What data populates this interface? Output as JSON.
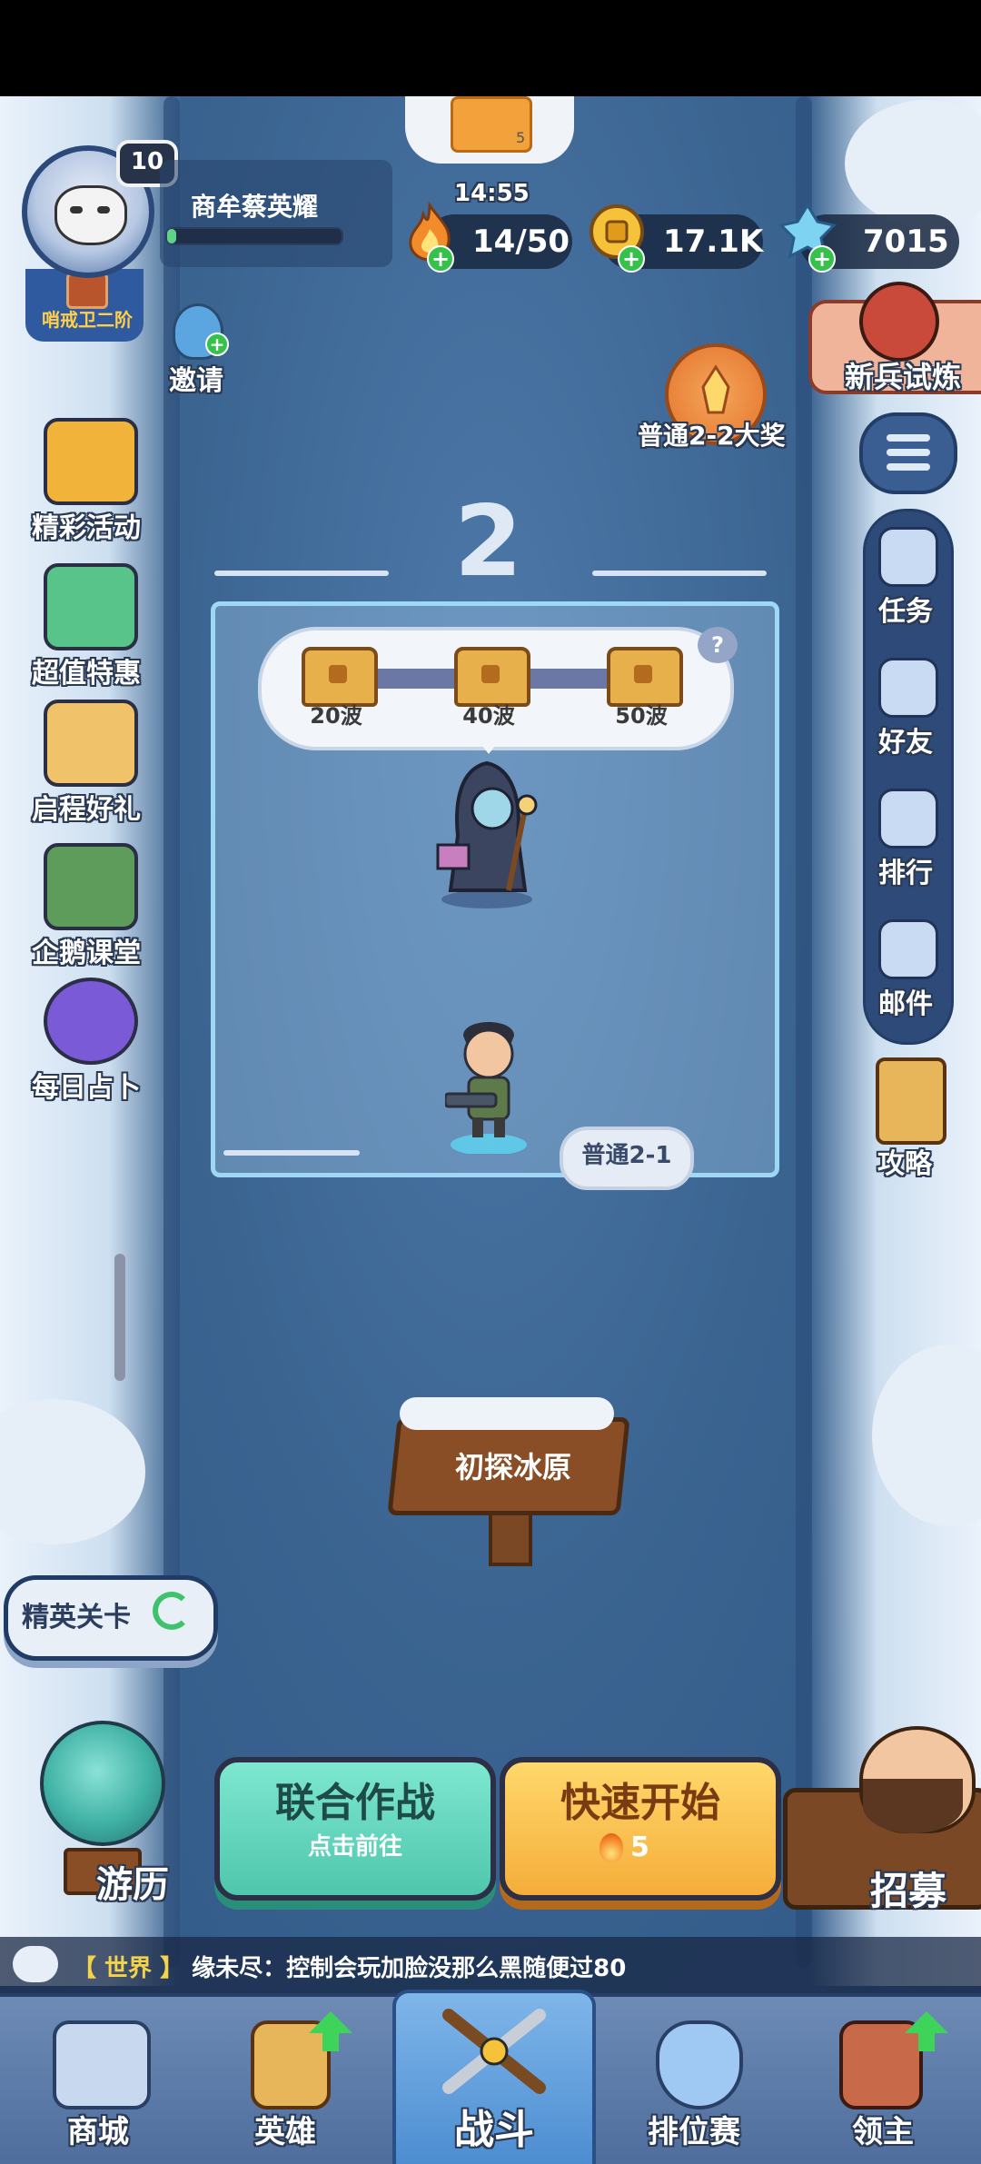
{
  "player": {
    "level": "10",
    "name": "商牟蔡英耀",
    "rank": "哨戒卫二阶",
    "xp_fraction": 0.05
  },
  "resources": {
    "timer": "14:55",
    "stamina": "14/50",
    "gold": "17.1K",
    "gems": "7015",
    "top_reward_count": "5"
  },
  "invite": {
    "label": "邀请"
  },
  "left_menu": [
    {
      "label": "精彩活动",
      "icon": "treasure-chest-icon"
    },
    {
      "label": "超值特惠",
      "icon": "stopwatch-icon"
    },
    {
      "label": "启程好礼",
      "icon": "griffin-icon"
    },
    {
      "label": "企鹅课堂",
      "icon": "penguin-teacher-icon"
    },
    {
      "label": "每日占卜",
      "icon": "crystal-ball-icon"
    }
  ],
  "right_menu": [
    {
      "label": "任务",
      "icon": "clipboard-icon"
    },
    {
      "label": "好友",
      "icon": "friends-icon"
    },
    {
      "label": "排行",
      "icon": "podium-icon"
    },
    {
      "label": "邮件",
      "icon": "mail-icon"
    }
  ],
  "strategy": {
    "label": "攻略"
  },
  "newbie_trial": {
    "label": "新兵试炼"
  },
  "big_reward": {
    "label": "普通2-2大奖"
  },
  "stage": {
    "number": "2",
    "waves": [
      "20波",
      "40波",
      "50波"
    ],
    "help": "?",
    "current": "普通2-1"
  },
  "area_name": "初探冰原",
  "elite": {
    "label": "精英关卡"
  },
  "coop": {
    "title": "联合作战",
    "subtitle": "点击前往"
  },
  "quick_start": {
    "title": "快速开始",
    "cost": "5"
  },
  "travel": {
    "label": "游历"
  },
  "recruit": {
    "label": "招募"
  },
  "chat": {
    "channel": "【 世界 】",
    "message": "缘未尽：控制会玩加脸没那么黑随便过80"
  },
  "nav": {
    "shop": "商城",
    "heroes": "英雄",
    "battle": "战斗",
    "ranked": "排位赛",
    "lord": "领主"
  },
  "colors": {
    "accent_green": "#4fc6ad",
    "accent_orange": "#f5ad3a",
    "nav_active": "#4b8cd0",
    "chat_tag": "#f3d34a"
  }
}
